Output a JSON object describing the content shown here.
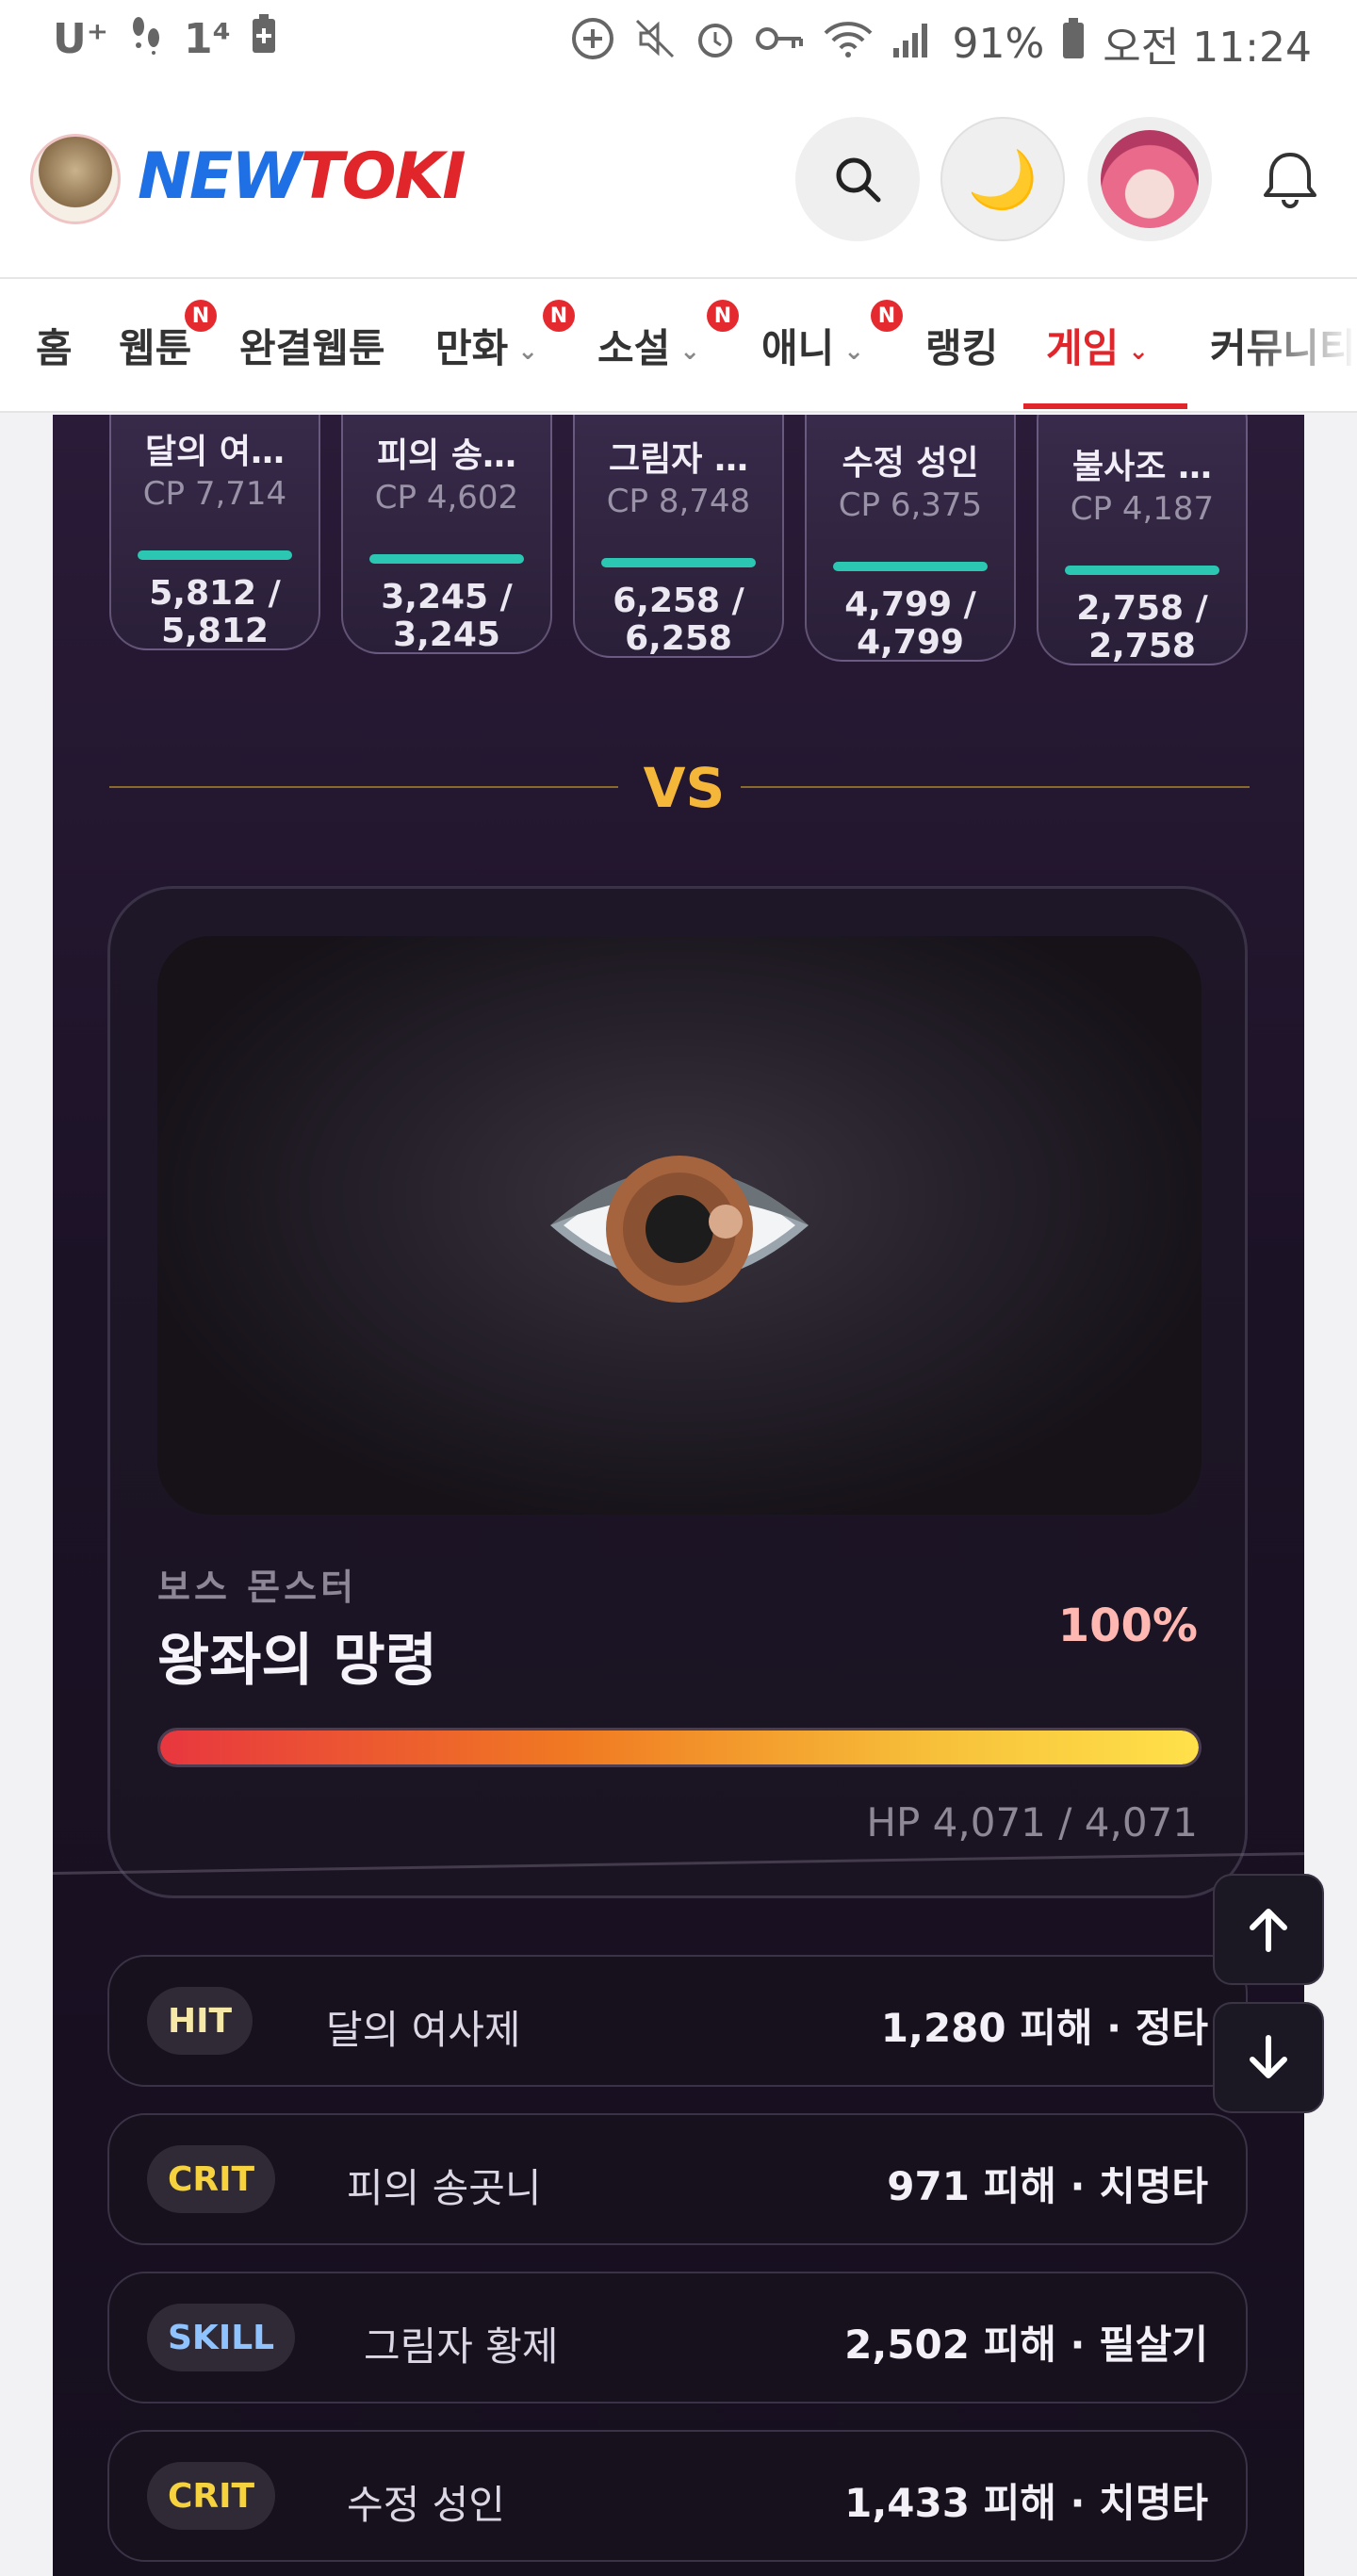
{
  "status_bar": {
    "carrier": "U⁺",
    "notif_count": "1⁴",
    "battery": "91%",
    "time": "오전 11:24"
  },
  "header": {
    "logo_new": "NEW",
    "logo_toki": "TOKI",
    "theme_icon": "🌙"
  },
  "nav": {
    "items": [
      {
        "label": "홈",
        "badge": "",
        "chevron": ""
      },
      {
        "label": "웹툰",
        "badge": "N",
        "chevron": ""
      },
      {
        "label": "완결웹툰",
        "badge": "",
        "chevron": ""
      },
      {
        "label": "만화",
        "badge": "N",
        "chevron": "⌄"
      },
      {
        "label": "소설",
        "badge": "N",
        "chevron": "⌄"
      },
      {
        "label": "애니",
        "badge": "N",
        "chevron": "⌄"
      },
      {
        "label": "랭킹",
        "badge": "",
        "chevron": ""
      },
      {
        "label": "게임",
        "badge": "",
        "chevron": "⌄"
      },
      {
        "label": "커뮤니티",
        "badge": "",
        "chevron": ""
      }
    ],
    "active": "게임"
  },
  "heroes": [
    {
      "name": "달의 여…",
      "cp": "CP 7,714",
      "hp_current": "5,812 /",
      "hp_max": "5,812"
    },
    {
      "name": "피의 송…",
      "cp": "CP 4,602",
      "hp_current": "3,245 /",
      "hp_max": "3,245"
    },
    {
      "name": "그림자 …",
      "cp": "CP 8,748",
      "hp_current": "6,258 /",
      "hp_max": "6,258"
    },
    {
      "name": "수정 성인",
      "cp": "CP 6,375",
      "hp_current": "4,799 /",
      "hp_max": "4,799"
    },
    {
      "name": "불사조 …",
      "cp": "CP 4,187",
      "hp_current": "2,758 /",
      "hp_max": "2,758"
    }
  ],
  "vs_label": "VS",
  "boss": {
    "label": "보스 몬스터",
    "name": "왕좌의 망령",
    "hp_percent_text": "100%",
    "hp_fraction": 1.0,
    "hp_text": "HP 4,071 / 4,071"
  },
  "battle_log": [
    {
      "tag": "HIT",
      "tag_type": "hit",
      "actor": "달의 여사제",
      "result": "1,280 피해 · 정타"
    },
    {
      "tag": "CRIT",
      "tag_type": "crit",
      "actor": "피의 송곳니",
      "result": "971 피해 · 치명타"
    },
    {
      "tag": "SKILL",
      "tag_type": "skill",
      "actor": "그림자 황제",
      "result": "2,502 피해 · 필살기"
    },
    {
      "tag": "CRIT",
      "tag_type": "crit",
      "actor": "수정 성인",
      "result": "1,433 피해 · 치명타"
    }
  ],
  "colors": {
    "brand_red": "#e0262b",
    "brand_blue": "#1f6fe5",
    "hero_bar": "#2bc7b3",
    "vs_gold": "#f5b73a"
  }
}
